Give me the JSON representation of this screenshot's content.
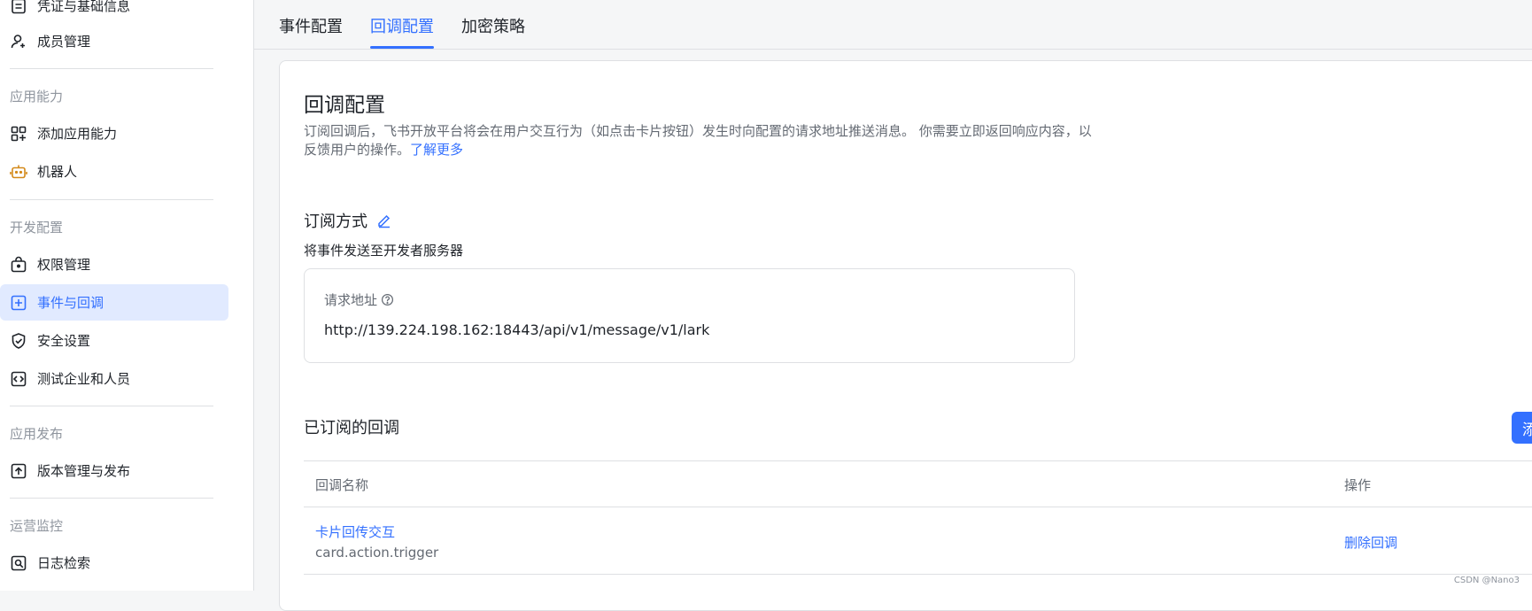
{
  "sidebar": {
    "items": [
      {
        "label": "凭证与基础信息",
        "icon": "document-icon"
      },
      {
        "label": "成员管理",
        "icon": "user-add-icon"
      },
      {
        "label": "添加应用能力",
        "icon": "apps-add-icon"
      },
      {
        "label": "机器人",
        "icon": "robot-icon"
      },
      {
        "label": "权限管理",
        "icon": "permission-icon"
      },
      {
        "label": "事件与回调",
        "icon": "event-icon"
      },
      {
        "label": "安全设置",
        "icon": "shield-icon"
      },
      {
        "label": "测试企业和人员",
        "icon": "code-icon"
      },
      {
        "label": "版本管理与发布",
        "icon": "upload-icon"
      },
      {
        "label": "日志检索",
        "icon": "log-search-icon"
      }
    ],
    "groups": [
      "应用能力",
      "开发配置",
      "应用发布",
      "运营监控"
    ]
  },
  "tabs": [
    "事件配置",
    "回调配置",
    "加密策略"
  ],
  "content": {
    "title": "回调配置",
    "desc_text": "订阅回调后，飞书开放平台将会在用户交互行为（如点击卡片按钮）发生时向配置的请求地址推送消息。 你需要立即返回响应内容，以反馈用户的操作。",
    "learn_more": "了解更多",
    "subscribe_title": "订阅方式",
    "subscribe_sub": "将事件发送至开发者服务器",
    "url_label": "请求地址",
    "url_value": "http://139.224.198.162:18443/api/v1/message/v1/lark",
    "subscribed_title": "已订阅的回调",
    "add_button": "添加回调",
    "table_headers": [
      "回调名称",
      "操作"
    ],
    "rows": [
      {
        "name": "卡片回传交互",
        "key": "card.action.trigger",
        "action": "删除回调"
      }
    ]
  },
  "watermark": "CSDN @Nano3",
  "colors": {
    "accent": "#3370ff",
    "active_bg": "#e1eaff"
  }
}
